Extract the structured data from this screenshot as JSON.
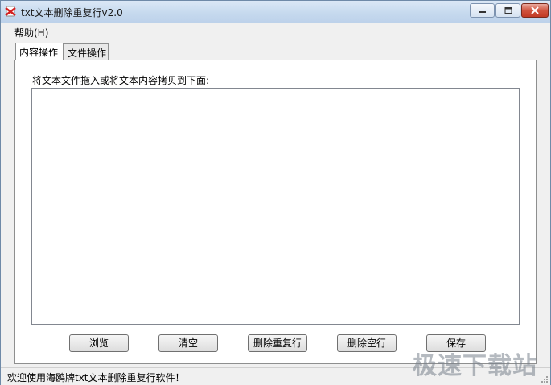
{
  "window": {
    "title": "txt文本删除重复行v2.0",
    "accent_close": "#c94a36"
  },
  "menu": {
    "help": "帮助(H)"
  },
  "tabs": [
    {
      "label": "内容操作",
      "active": true
    },
    {
      "label": "文件操作",
      "active": false
    }
  ],
  "panel": {
    "instruction": "将文本文件拖入或将文本内容拷贝到下面:",
    "text_content": ""
  },
  "buttons": {
    "browse": "浏览",
    "clear": "清空",
    "delete_duplicates": "删除重复行",
    "delete_blank": "删除空行",
    "save": "保存"
  },
  "status": {
    "message": "欢迎使用海鸥牌txt文本删除重复行软件！"
  },
  "watermark": "极速下载站"
}
